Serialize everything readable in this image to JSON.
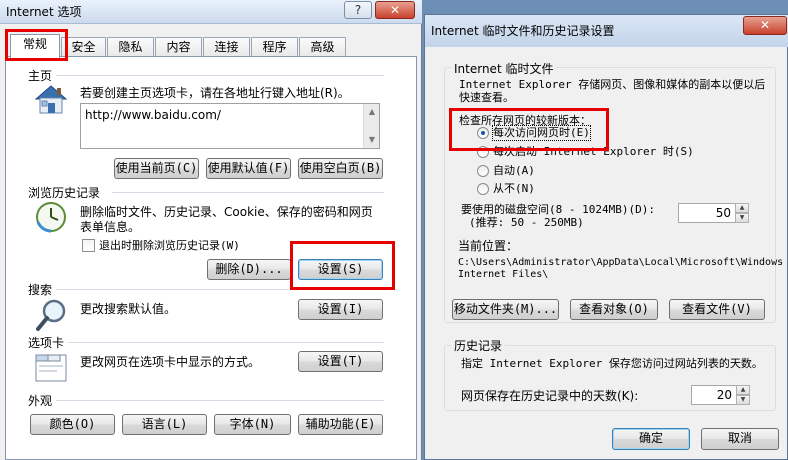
{
  "left_dialog": {
    "title": "Internet 选项",
    "help_button": "?",
    "close_button": "✕",
    "tabs": [
      "常规",
      "安全",
      "隐私",
      "内容",
      "连接",
      "程序",
      "高级"
    ],
    "homepage": {
      "section": "主页",
      "description": "若要创建主页选项卡，请在各地址行键入地址(R)。",
      "url": "http://www.baidu.com/",
      "btn_current": "使用当前页(C)",
      "btn_default": "使用默认值(F)",
      "btn_blank": "使用空白页(B)"
    },
    "history": {
      "section": "浏览历史记录",
      "description_line1": "删除临时文件、历史记录、Cookie、保存的密码和网页",
      "description_line2": "表单信息。",
      "checkbox_label": "退出时删除浏览历史记录(W)",
      "btn_delete": "删除(D)...",
      "btn_settings": "设置(S)"
    },
    "search": {
      "section": "搜索",
      "description": "更改搜索默认值。",
      "btn_settings": "设置(I)"
    },
    "tabs_section": {
      "section": "选项卡",
      "description": "更改网页在选项卡中显示的方式。",
      "btn_settings": "设置(T)"
    },
    "appearance": {
      "section": "外观",
      "btn_colors": "颜色(O)",
      "btn_languages": "语言(L)",
      "btn_fonts": "字体(N)",
      "btn_accessibility": "辅助功能(E)"
    }
  },
  "right_dialog": {
    "title": "Internet 临时文件和历史记录设置",
    "close_button": "✕",
    "temp_files": {
      "group": "Internet 临时文件",
      "description_line1": "Internet Explorer 存储网页、图像和媒体的副本以便以后",
      "description_line2": "快速查看。",
      "check_label": "检查所存网页的较新版本：",
      "radios": [
        {
          "label": "每次访问网页时(E)",
          "selected": true
        },
        {
          "label": "每次启动 Internet Explorer 时(S)",
          "selected": false
        },
        {
          "label": "自动(A)",
          "selected": false
        },
        {
          "label": "从不(N)",
          "selected": false
        }
      ],
      "disk_label": "要使用的磁盘空间(8 - 1024MB)(D):",
      "disk_recommend": "(推荐: 50 - 250MB)",
      "disk_value": "50",
      "location_label": "当前位置：",
      "location_path_line1": "C:\\Users\\Administrator\\AppData\\Local\\Microsoft\\Windows",
      "location_path_line2": "Internet Files\\",
      "btn_move": "移动文件夹(M)...",
      "btn_view_objects": "查看对象(O)",
      "btn_view_files": "查看文件(V)"
    },
    "history": {
      "group": "历史记录",
      "description": "指定 Internet Explorer 保存您访问过网站列表的天数。",
      "days_label": "网页保存在历史记录中的天数(K):",
      "days_value": "20"
    },
    "btn_ok": "确定",
    "btn_cancel": "取消"
  },
  "colors": {
    "highlight": "#e60000",
    "selection_text_bg": "#3399ff"
  }
}
